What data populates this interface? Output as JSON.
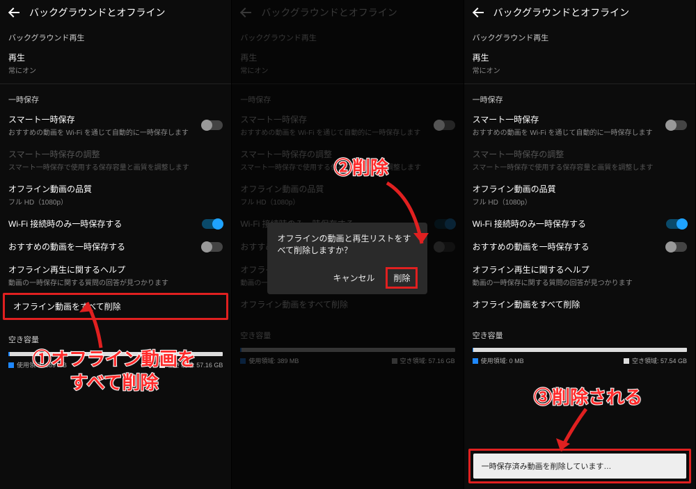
{
  "header_title": "バックグラウンドとオフライン",
  "bg_section": "バックグラウンド再生",
  "playback_title": "再生",
  "playback_sub": "常にオン",
  "save_section": "一時保存",
  "smart_title": "スマート一時保存",
  "smart_sub": "おすすめの動画を Wi-Fi を通じて自動的に一時保存します",
  "smart_adj_title": "スマート一時保存の調整",
  "smart_adj_sub": "スマート一時保存で使用する保存容量と画質を調整します",
  "quality_title": "オフライン動画の品質",
  "quality_sub": "フル HD（1080p）",
  "wifi_only_title": "Wi-Fi 接続時のみ一時保存する",
  "recommend_title": "おすすめの動画を一時保存する",
  "help_title": "オフライン再生に関するヘルプ",
  "help_sub": "動画の一時保存に関する質問の回答が見つかります",
  "delete_all_title": "オフライン動画をすべて削除",
  "free_space_label": "空き容量",
  "legend_used_1": "使用領域: 389 MB",
  "legend_free_1": "空き領域: 57.16 GB",
  "legend_used_3": "使用領域: 0 MB",
  "legend_free_3": "空き領域: 57.54 GB",
  "dialog_text": "オフラインの動画と再生リストをすべて削除しますか？",
  "dialog_cancel": "キャンセル",
  "dialog_delete": "削除",
  "toast_text": "一時保存済み動画を削除しています…",
  "callout1": "①オフライン動画を\nすべて削除",
  "callout2": "②削除",
  "callout3": "③削除される",
  "colors": {
    "highlight": "#e02020",
    "accent": "#1fa3ff"
  }
}
